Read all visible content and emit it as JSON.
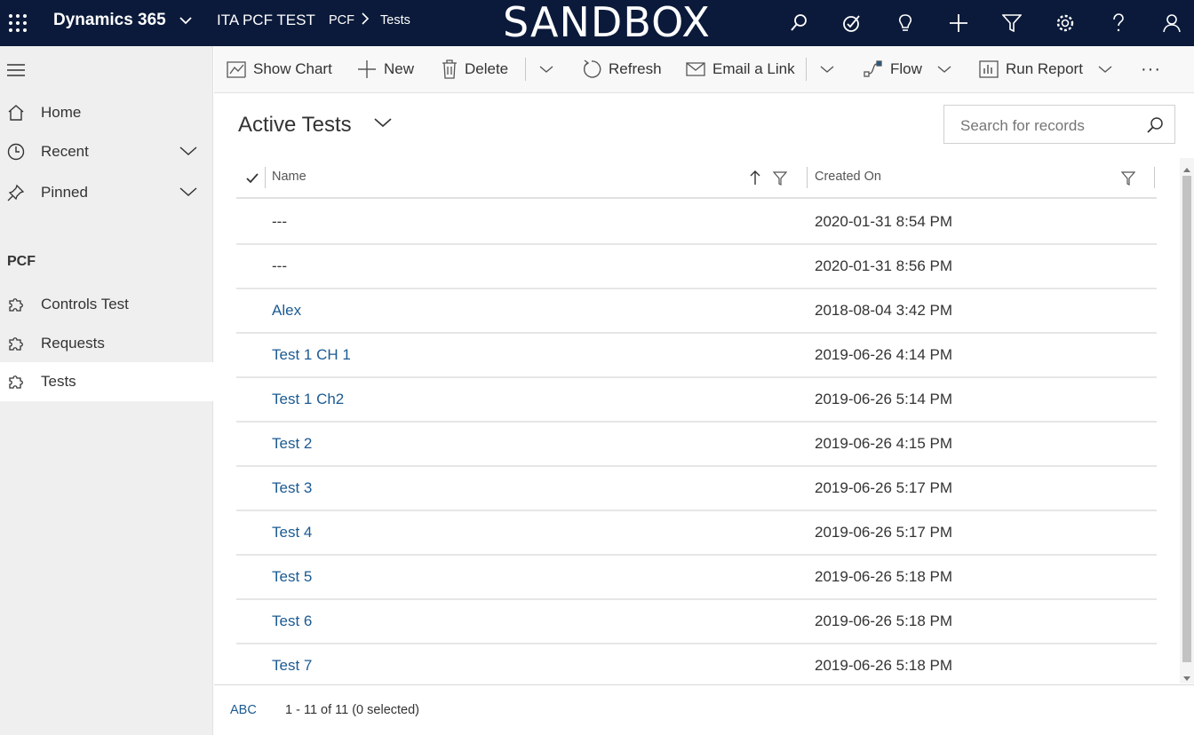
{
  "topbar": {
    "app_name": "Dynamics 365",
    "environment": "ITA PCF TEST",
    "breadcrumb": [
      "PCF",
      "Tests"
    ],
    "banner": "SANDBOX"
  },
  "leftnav": {
    "items": [
      {
        "label": "Home"
      },
      {
        "label": "Recent"
      },
      {
        "label": "Pinned"
      }
    ],
    "section_title": "PCF",
    "entities": [
      {
        "label": "Controls Test"
      },
      {
        "label": "Requests"
      },
      {
        "label": "Tests"
      }
    ]
  },
  "commandbar": {
    "show_chart": "Show Chart",
    "new": "New",
    "delete": "Delete",
    "refresh": "Refresh",
    "email_link": "Email a Link",
    "flow": "Flow",
    "run_report": "Run Report",
    "more": "···"
  },
  "view": {
    "title": "Active Tests",
    "search_placeholder": "Search for records"
  },
  "grid": {
    "columns": [
      "Name",
      "Created On"
    ],
    "rows": [
      {
        "name": "---",
        "created_on": "2020-01-31 8:54 PM"
      },
      {
        "name": "---",
        "created_on": "2020-01-31 8:56 PM"
      },
      {
        "name": "Alex",
        "created_on": "2018-08-04 3:42 PM"
      },
      {
        "name": "Test 1 CH 1",
        "created_on": "2019-06-26 4:14 PM"
      },
      {
        "name": "Test 1 Ch2",
        "created_on": "2019-06-26 5:14 PM"
      },
      {
        "name": "Test 2",
        "created_on": "2019-06-26 4:15 PM"
      },
      {
        "name": "Test 3",
        "created_on": "2019-06-26 5:17 PM"
      },
      {
        "name": "Test 4",
        "created_on": "2019-06-26 5:17 PM"
      },
      {
        "name": "Test 5",
        "created_on": "2019-06-26 5:18 PM"
      },
      {
        "name": "Test 6",
        "created_on": "2019-06-26 5:18 PM"
      },
      {
        "name": "Test 7",
        "created_on": "2019-06-26 5:18 PM"
      }
    ]
  },
  "footer": {
    "jump_bar": "ABC",
    "record_count": "1 - 11 of 11 (0 selected)"
  },
  "colors": {
    "topbar_bg": "#0b1a3a",
    "link": "#1b5a92",
    "nav_bg": "#efefef"
  }
}
